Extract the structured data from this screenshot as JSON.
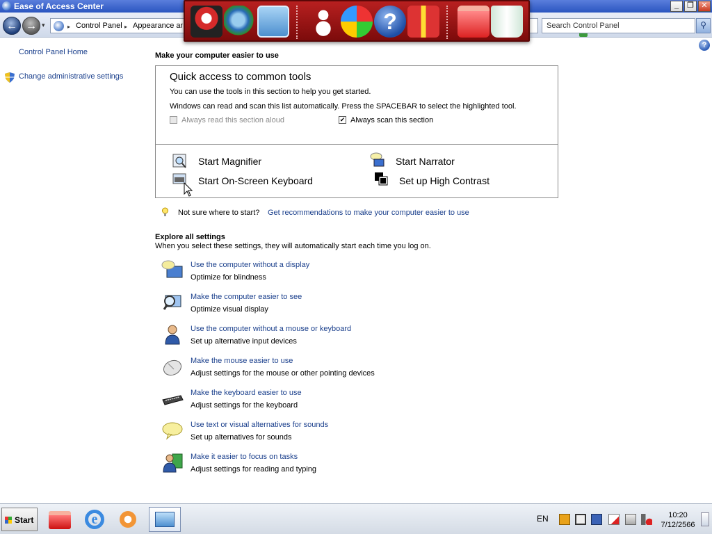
{
  "window": {
    "title": "Ease of Access Center",
    "buttons": {
      "minimize": "_",
      "restore": "❐",
      "close": "✕"
    }
  },
  "navigation": {
    "breadcrumb": [
      "Control Panel",
      "Appearance an"
    ],
    "search_placeholder": "Search Control Panel"
  },
  "sidebar": {
    "home_link": "Control Panel Home",
    "admin_link": "Change administrative settings"
  },
  "main": {
    "heading": "Make your computer easier to use",
    "quick_access": {
      "title": "Quick access to common tools",
      "line1": "You can use the tools in this section to help you get started.",
      "line2": "Windows can read and scan this list automatically.  Press the SPACEBAR to select the highlighted tool.",
      "always_read": {
        "label": "Always read this section aloud",
        "checked": false,
        "disabled": true
      },
      "always_scan": {
        "label": "Always scan this section",
        "checked": true
      },
      "tools": [
        {
          "label": "Start Magnifier",
          "icon": "magnifier-icon"
        },
        {
          "label": "Start Narrator",
          "icon": "narrator-icon"
        },
        {
          "label": "Start On-Screen Keyboard",
          "icon": "onscreen-keyboard-icon"
        },
        {
          "label": "Set up High Contrast",
          "icon": "high-contrast-icon"
        }
      ]
    },
    "tip": {
      "text": "Not sure where to start?",
      "link": "Get recommendations to make your computer easier to use"
    },
    "explore": {
      "heading": "Explore all settings",
      "description": "When you select these settings, they will automatically start each time you log on.",
      "items": [
        {
          "link": "Use the computer without a display",
          "desc": "Optimize for blindness",
          "icon": "speech-monitor-icon"
        },
        {
          "link": "Make the computer easier to see",
          "desc": "Optimize visual display",
          "icon": "magnify-monitor-icon"
        },
        {
          "link": "Use the computer without a mouse or keyboard",
          "desc": "Set up alternative input devices",
          "icon": "user-icon"
        },
        {
          "link": "Make the mouse easier to use",
          "desc": "Adjust settings for the mouse or other pointing devices",
          "icon": "mouse-icon"
        },
        {
          "link": "Make the keyboard easier to use",
          "desc": "Adjust settings for the keyboard",
          "icon": "keyboard-icon"
        },
        {
          "link": "Use text or visual alternatives for sounds",
          "desc": "Set up alternatives for sounds",
          "icon": "speech-bubble-icon"
        },
        {
          "link": "Make it easier to focus on tasks",
          "desc": "Adjust settings for reading and typing",
          "icon": "user-document-icon"
        }
      ]
    }
  },
  "taskbar": {
    "start_label": "Start",
    "language": "EN",
    "time": "10:20",
    "date": "7/12/2566"
  },
  "colors": {
    "link": "#1a3f8c",
    "titlebar": "#2a55c0",
    "dock": "#9c1414"
  }
}
